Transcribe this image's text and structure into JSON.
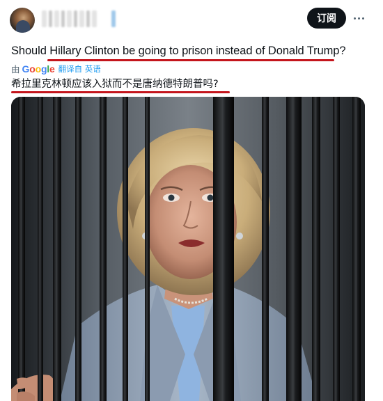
{
  "header": {
    "subscribe_label": "订阅",
    "more_icon": "more-horizontal-icon"
  },
  "tweet": {
    "text": "Should Hillary Clinton be going to prison instead of Donald Trump?",
    "translation": {
      "by_label": "由",
      "provider": "Google",
      "link_label": "翻译自 英语",
      "text": "希拉里克林顿应该入狱而不是唐纳德特朗普吗?"
    },
    "media": {
      "icon": "photo-prison-bars-image"
    }
  },
  "colors": {
    "subscribe_bg": "#0f1419",
    "underline": "#c4151c",
    "link": "#1d9bf0",
    "google_blue": "#4285f4",
    "google_red": "#ea4335",
    "google_yellow": "#fbbc05",
    "google_green": "#34a853"
  }
}
